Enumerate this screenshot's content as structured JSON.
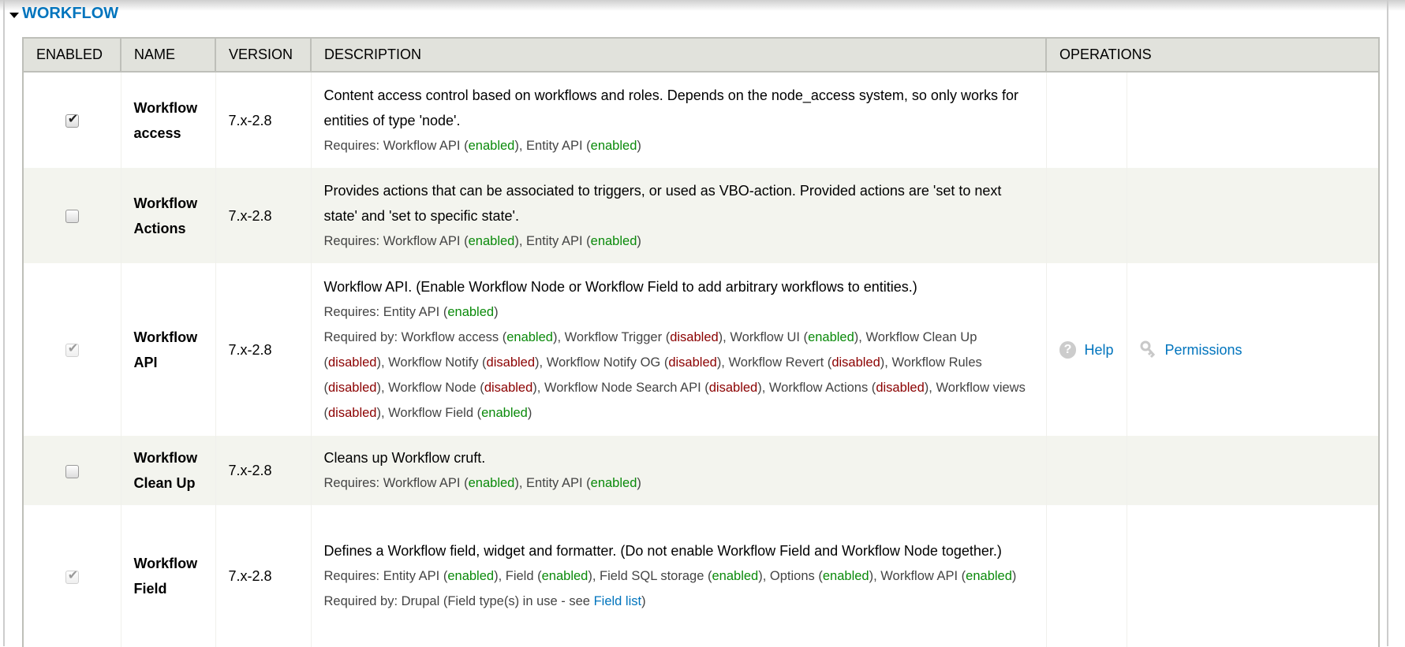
{
  "section": {
    "title": "WORKFLOW"
  },
  "headers": [
    "Enabled",
    "Name",
    "Version",
    "Description",
    "Operations"
  ],
  "rows": [
    {
      "name_line1": "Workflow",
      "name_line2": "access",
      "enabled": true,
      "locked": false,
      "version": "7.x-2.8",
      "description": "Content access control based on workflows and roles. Depends on the node_access system, so only works for entities of type 'node'.",
      "requires": [
        {
          "name": "Workflow API",
          "status": "enabled"
        },
        {
          "name": "Entity API",
          "status": "enabled"
        }
      ]
    },
    {
      "name_line1": "Workflow",
      "name_line2": "Actions",
      "enabled": false,
      "locked": false,
      "version": "7.x-2.8",
      "description": "Provides actions that can be associated to triggers, or used as VBO-action. Provided actions are 'set to next state' and 'set to specific state'.",
      "requires": [
        {
          "name": "Workflow API",
          "status": "enabled"
        },
        {
          "name": "Entity API",
          "status": "enabled"
        }
      ]
    },
    {
      "name_line1": "Workflow",
      "name_line2": "API",
      "enabled": true,
      "locked": true,
      "version": "7.x-2.8",
      "description": "Workflow API. (Enable Workflow Node or Workflow Field to add arbitrary workflows to entities.)",
      "requires": [
        {
          "name": "Entity API",
          "status": "enabled"
        }
      ],
      "required_by": [
        {
          "name": "Workflow access",
          "status": "enabled"
        },
        {
          "name": "Workflow Trigger",
          "status": "disabled"
        },
        {
          "name": "Workflow UI",
          "status": "enabled"
        },
        {
          "name": "Workflow Clean Up",
          "status": "disabled"
        },
        {
          "name": "Workflow Notify",
          "status": "disabled"
        },
        {
          "name": "Workflow Notify OG",
          "status": "disabled"
        },
        {
          "name": "Workflow Revert",
          "status": "disabled"
        },
        {
          "name": "Workflow Rules",
          "status": "disabled"
        },
        {
          "name": "Workflow Node",
          "status": "disabled"
        },
        {
          "name": "Workflow Node Search API",
          "status": "disabled"
        },
        {
          "name": "Workflow Actions",
          "status": "disabled"
        },
        {
          "name": "Workflow views",
          "status": "disabled"
        },
        {
          "name": "Workflow Field",
          "status": "enabled"
        }
      ],
      "operations": {
        "help": "Help",
        "permissions": "Permissions"
      }
    },
    {
      "name_line1": "Workflow",
      "name_line2": "Clean Up",
      "enabled": false,
      "locked": false,
      "version": "7.x-2.8",
      "description": "Cleans up Workflow cruft.",
      "requires": [
        {
          "name": "Workflow API",
          "status": "enabled"
        },
        {
          "name": "Entity API",
          "status": "enabled"
        }
      ]
    },
    {
      "name_line1": "Workflow",
      "name_line2": "Field",
      "enabled": true,
      "locked": true,
      "version": "7.x-2.8",
      "description": "Defines a Workflow field, widget and formatter. (Do not enable Workflow Field and Workflow Node together.)",
      "requires": [
        {
          "name": "Entity API",
          "status": "enabled"
        },
        {
          "name": "Field",
          "status": "enabled"
        },
        {
          "name": "Field SQL storage",
          "status": "enabled"
        },
        {
          "name": "Options",
          "status": "enabled"
        },
        {
          "name": "Workflow API",
          "status": "enabled"
        }
      ],
      "required_by_text": "Drupal (Field type(s) in use - see ",
      "required_by_link": "Field list"
    }
  ],
  "labels": {
    "requires": "Requires: ",
    "required_by": "Required by: "
  },
  "colors": {
    "link": "#0074bd",
    "enabled": "#0a8a0a",
    "disabled": "#8b0000"
  }
}
